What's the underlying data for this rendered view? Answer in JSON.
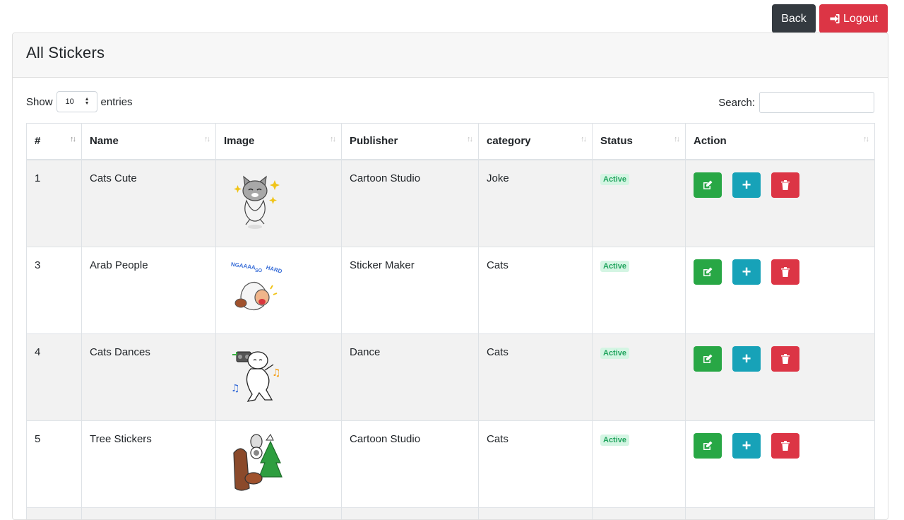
{
  "toolbar": {
    "back_label": "Back",
    "logout_label": "Logout"
  },
  "card": {
    "title": "All Stickers"
  },
  "controls": {
    "show_label": "Show",
    "entries_value": "10",
    "entries_label": "entries",
    "search_label": "Search:",
    "search_value": ""
  },
  "table": {
    "columns": [
      "#",
      "Name",
      "Image",
      "Publisher",
      "category",
      "Status",
      "Action"
    ],
    "rows": [
      {
        "id": "1",
        "name": "Cats Cute",
        "image": "cat-sticker",
        "publisher": "Cartoon Studio",
        "category": "Joke",
        "status": "Active"
      },
      {
        "id": "3",
        "name": "Arab People",
        "image": "arab-man-sticker",
        "publisher": "Sticker Maker",
        "category": "Cats",
        "status": "Active"
      },
      {
        "id": "4",
        "name": "Cats Dances",
        "image": "dancing-cat-sticker",
        "publisher": "Dance",
        "category": "Cats",
        "status": "Active"
      },
      {
        "id": "5",
        "name": "Tree Stickers",
        "image": "tree-characters-sticker",
        "publisher": "Cartoon Studio",
        "category": "Cats",
        "status": "Active"
      }
    ]
  },
  "colors": {
    "back": "#343a40",
    "logout": "#dc3545",
    "edit": "#28a745",
    "add": "#17a2b8",
    "delete": "#dc3545",
    "active_badge": "#1fa35c"
  }
}
